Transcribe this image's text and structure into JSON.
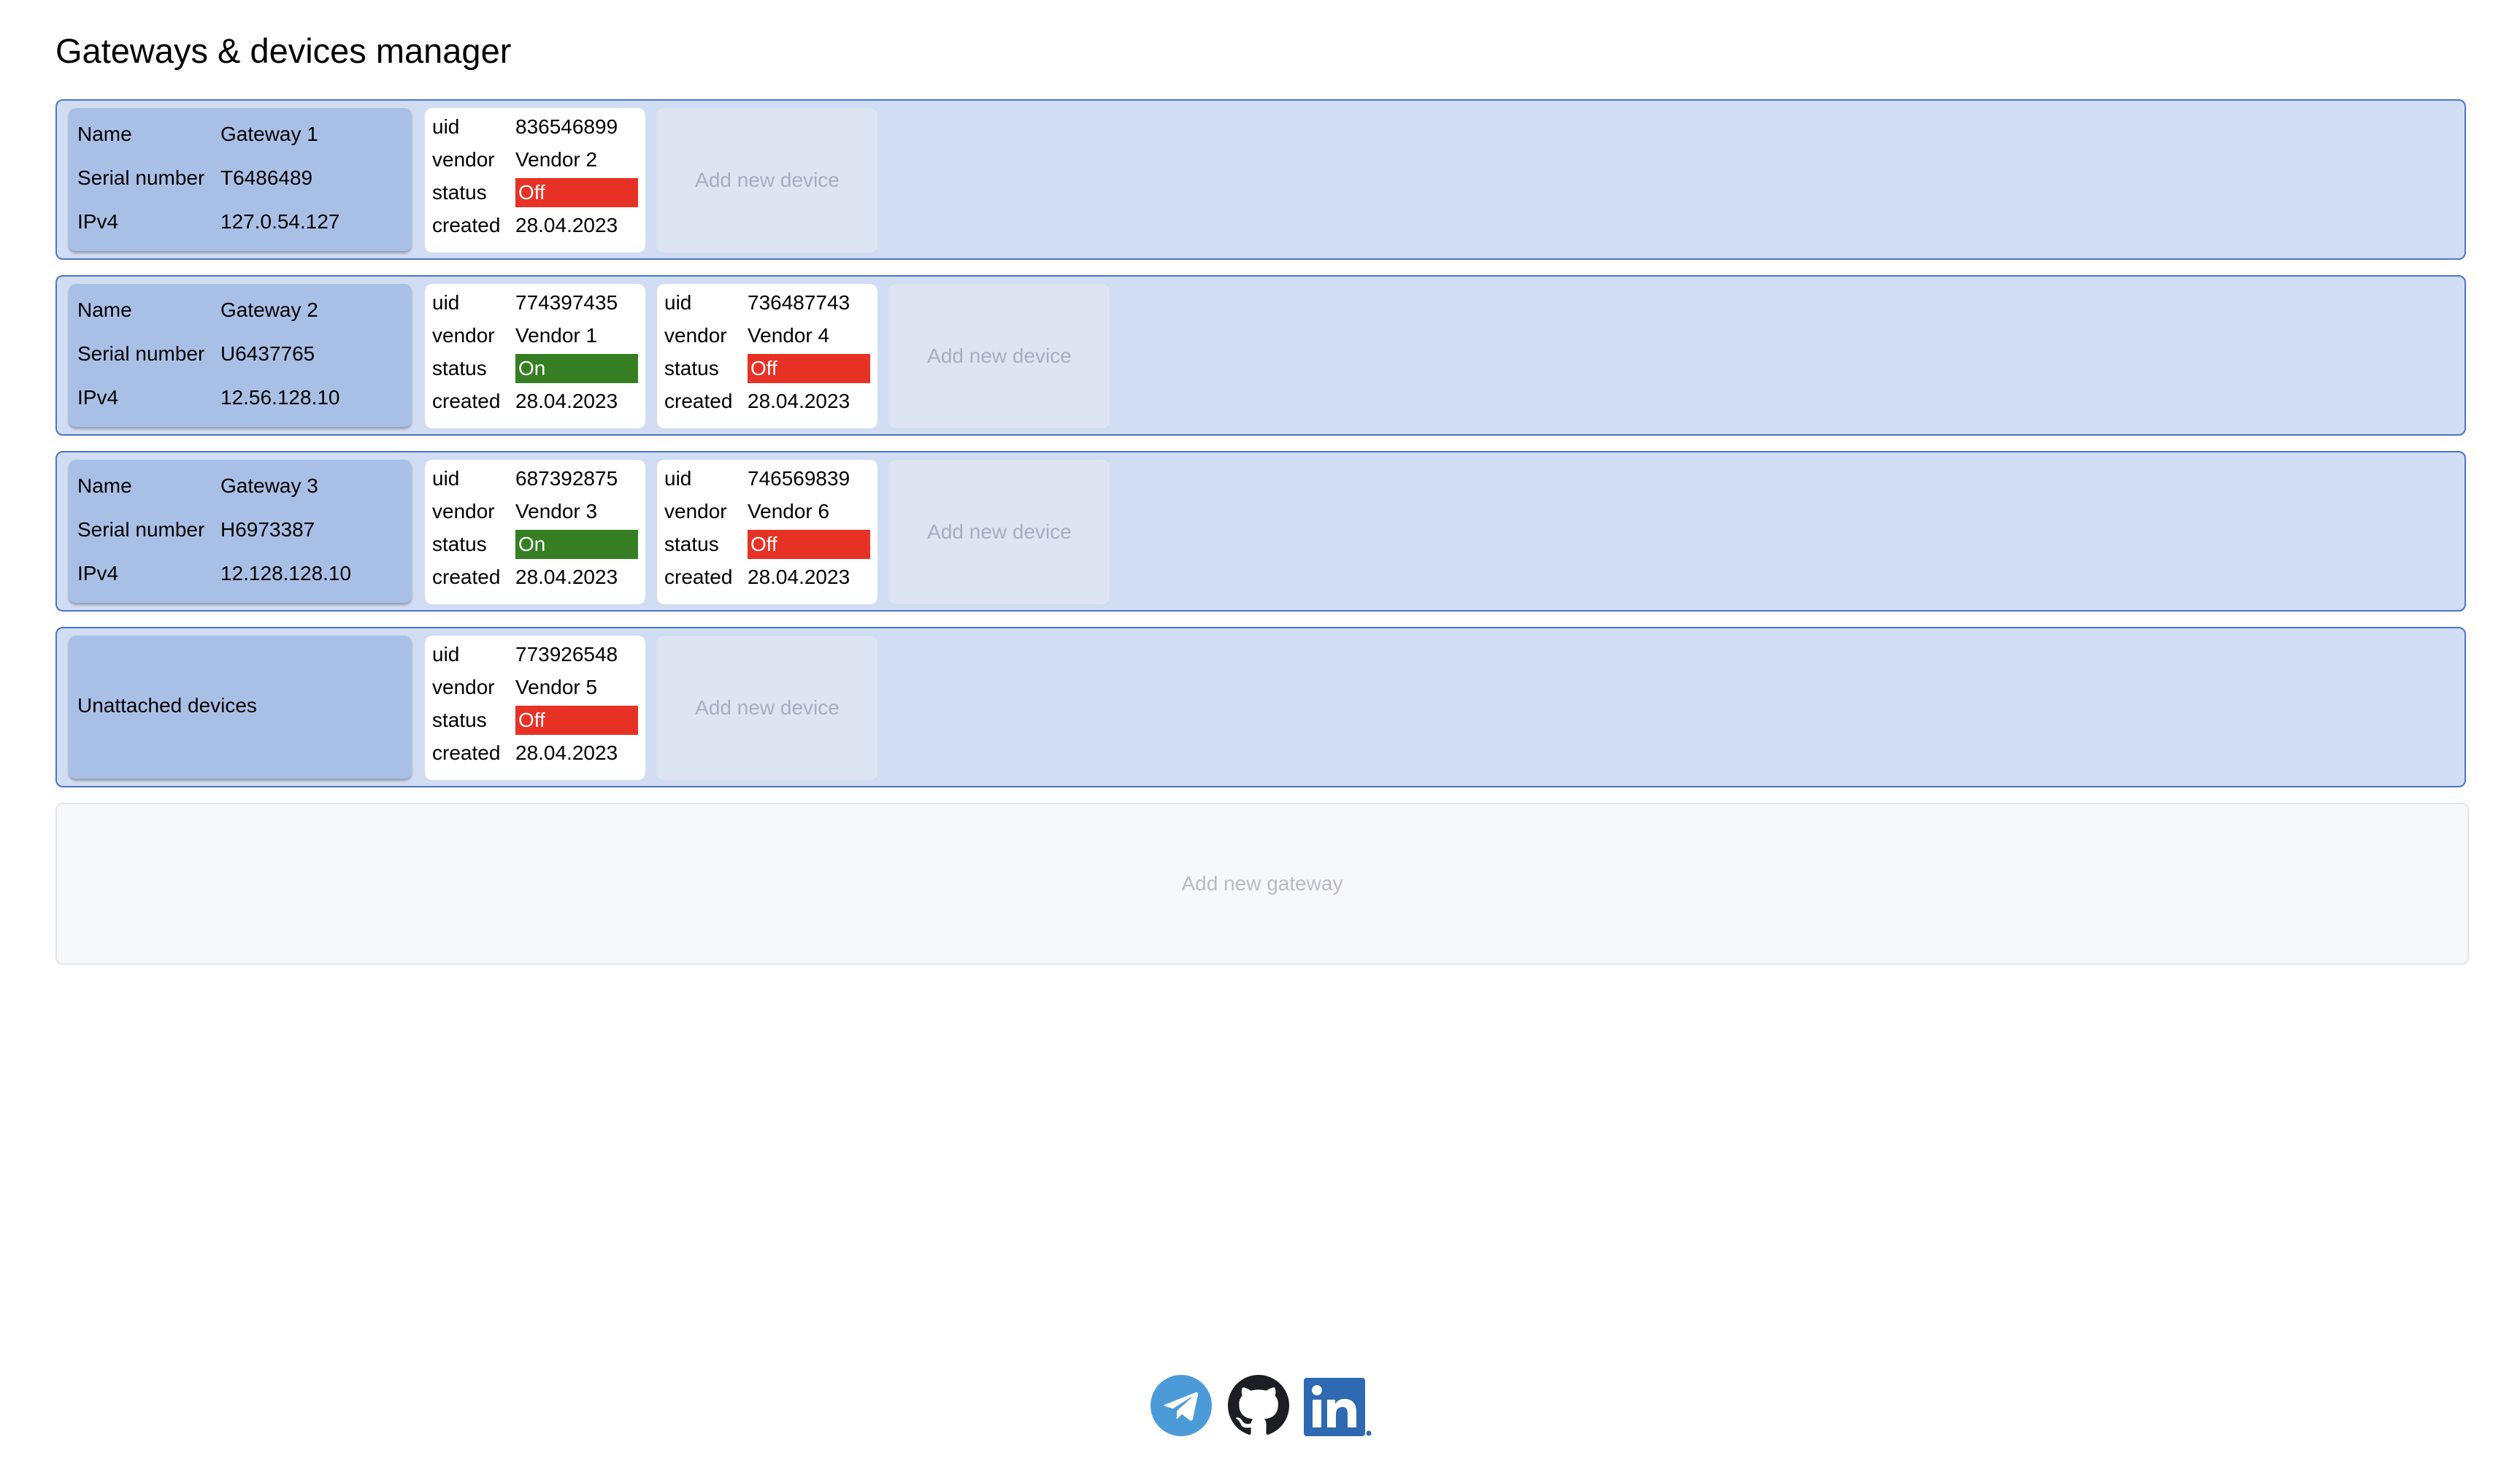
{
  "page": {
    "title": "Gateways & devices manager"
  },
  "labels": {
    "name": "Name",
    "serial": "Serial number",
    "ipv4": "IPv4",
    "uid": "uid",
    "vendor": "vendor",
    "status": "status",
    "created": "created",
    "add_device": "Add new device",
    "add_gateway": "Add new gateway"
  },
  "gateways": [
    {
      "name": "Gateway 1",
      "serial": "T6486489",
      "ipv4": "127.0.54.127",
      "devices": [
        {
          "uid": "836546899",
          "vendor": "Vendor 2",
          "status": "Off",
          "created": "28.04.2023"
        }
      ]
    },
    {
      "name": "Gateway 2",
      "serial": "U6437765",
      "ipv4": "12.56.128.10",
      "devices": [
        {
          "uid": "774397435",
          "vendor": "Vendor 1",
          "status": "On",
          "created": "28.04.2023"
        },
        {
          "uid": "736487743",
          "vendor": "Vendor 4",
          "status": "Off",
          "created": "28.04.2023"
        }
      ]
    },
    {
      "name": "Gateway 3",
      "serial": "H6973387",
      "ipv4": "12.128.128.10",
      "devices": [
        {
          "uid": "687392875",
          "vendor": "Vendor 3",
          "status": "On",
          "created": "28.04.2023"
        },
        {
          "uid": "746569839",
          "vendor": "Vendor 6",
          "status": "Off",
          "created": "28.04.2023"
        }
      ]
    }
  ],
  "unattached": {
    "label": "Unattached devices",
    "devices": [
      {
        "uid": "773926548",
        "vendor": "Vendor 5",
        "status": "Off",
        "created": "28.04.2023"
      }
    ]
  },
  "status_colors": {
    "On": "#357f22",
    "Off": "#e83125"
  },
  "footer": {
    "links": [
      {
        "icon": "telegram-icon",
        "color": "#4c9bd9"
      },
      {
        "icon": "github-icon",
        "color": "#1b1f23"
      },
      {
        "icon": "linkedin-icon",
        "color": "#2e69b2"
      }
    ]
  }
}
